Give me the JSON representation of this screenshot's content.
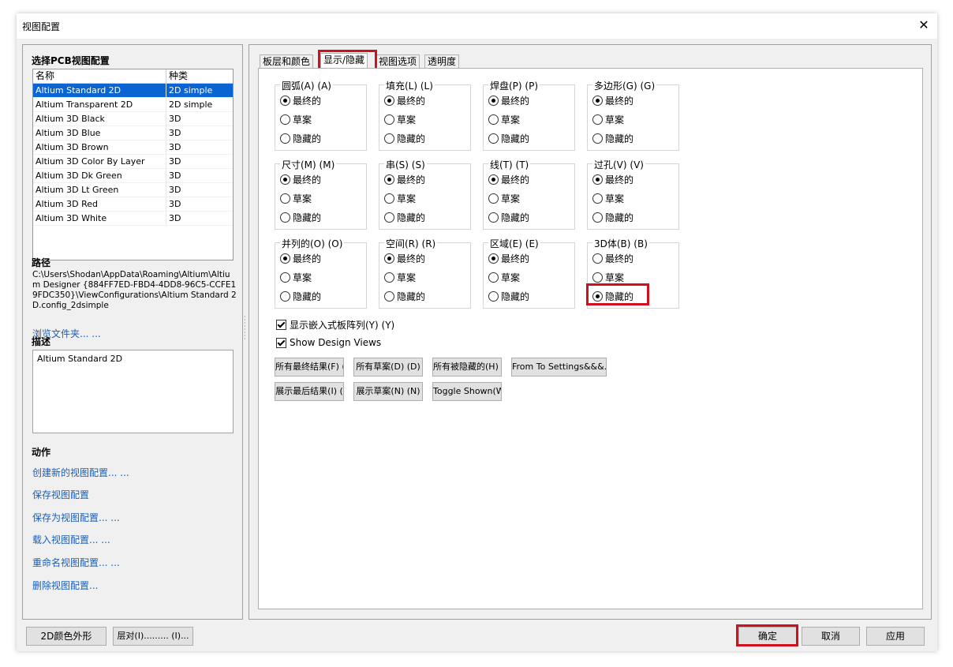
{
  "window": {
    "title": "视图配置",
    "close_symbol": "✕"
  },
  "left": {
    "select_title": "选择PCB视图配置",
    "columns": [
      "名称",
      "种类"
    ],
    "rows": [
      {
        "name": "Altium Standard 2D",
        "kind": "2D simple"
      },
      {
        "name": "Altium Transparent 2D",
        "kind": "2D simple"
      },
      {
        "name": "Altium 3D Black",
        "kind": "3D"
      },
      {
        "name": "Altium 3D Blue",
        "kind": "3D"
      },
      {
        "name": "Altium 3D Brown",
        "kind": "3D"
      },
      {
        "name": "Altium 3D Color By Layer",
        "kind": "3D"
      },
      {
        "name": "Altium 3D Dk Green",
        "kind": "3D"
      },
      {
        "name": "Altium 3D Lt Green",
        "kind": "3D"
      },
      {
        "name": "Altium 3D Red",
        "kind": "3D"
      },
      {
        "name": "Altium 3D White",
        "kind": "3D"
      }
    ],
    "path_title": "路径",
    "path_value": "C:\\Users\\Shodan\\AppData\\Roaming\\Altium\\Altium Designer {884FF7ED-FBD4-4DD8-96C5-CCFE19FDC350}\\ViewConfigurations\\Altium Standard 2D.config_2dsimple",
    "browse_link": "浏览文件夹... ...",
    "desc_title": "描述",
    "desc_value": "Altium Standard 2D",
    "actions_title": "动作",
    "actions": [
      "创建新的视图配置... ...",
      "保存视图配置",
      "保存为视图配置... ...",
      "载入视图配置... ...",
      "重命名视图配置... ...",
      "删除视图配置..."
    ]
  },
  "tabs": [
    "板层和颜色",
    "显示/隐藏",
    "视图选项",
    "透明度"
  ],
  "groups": [
    {
      "title": "圆弧(A) (A)",
      "options": [
        "最终的",
        "草案",
        "隐藏的"
      ],
      "selected": 0
    },
    {
      "title": "填充(L) (L)",
      "options": [
        "最终的",
        "草案",
        "隐藏的"
      ],
      "selected": 0
    },
    {
      "title": "焊盘(P) (P)",
      "options": [
        "最终的",
        "草案",
        "隐藏的"
      ],
      "selected": 0
    },
    {
      "title": "多边形(G) (G)",
      "options": [
        "最终的",
        "草案",
        "隐藏的"
      ],
      "selected": 0
    },
    {
      "title": "尺寸(M) (M)",
      "options": [
        "最终的",
        "草案",
        "隐藏的"
      ],
      "selected": 0
    },
    {
      "title": "串(S) (S)",
      "options": [
        "最终的",
        "草案",
        "隐藏的"
      ],
      "selected": 0
    },
    {
      "title": "线(T) (T)",
      "options": [
        "最终的",
        "草案",
        "隐藏的"
      ],
      "selected": 0
    },
    {
      "title": "过孔(V) (V)",
      "options": [
        "最终的",
        "草案",
        "隐藏的"
      ],
      "selected": 0
    },
    {
      "title": "并列的(O) (O)",
      "options": [
        "最终的",
        "草案",
        "隐藏的"
      ],
      "selected": 0
    },
    {
      "title": "空间(R) (R)",
      "options": [
        "最终的",
        "草案",
        "隐藏的"
      ],
      "selected": 0
    },
    {
      "title": "区域(E) (E)",
      "options": [
        "最终的",
        "草案",
        "隐藏的"
      ],
      "selected": 0
    },
    {
      "title": "3D体(B) (B)",
      "options": [
        "最终的",
        "草案",
        "隐藏的"
      ],
      "selected": 2
    }
  ],
  "checkboxes": [
    {
      "label": "显示嵌入式板阵列(Y) (Y)",
      "checked": true
    },
    {
      "label": "Show Design Views",
      "checked": true
    }
  ],
  "buttons_row1": [
    "所有最终结果(F) (",
    "所有草案(D) (D)",
    "所有被隐藏的(H) (",
    "From To Settings&&&..."
  ],
  "buttons_row2": [
    "展示最后结果(I) (",
    "展示草案(N) (N)",
    "Toggle Shown(W) ("
  ],
  "footer": {
    "left_buttons": [
      "2D颜色外形",
      "层对(I)......... (I)..."
    ],
    "ok": "确定",
    "cancel": "取消",
    "apply": "应用"
  },
  "colors": {
    "accent_selection": "#0a64d2",
    "highlight_box": "#d0101f",
    "link": "#1a5fb4"
  }
}
